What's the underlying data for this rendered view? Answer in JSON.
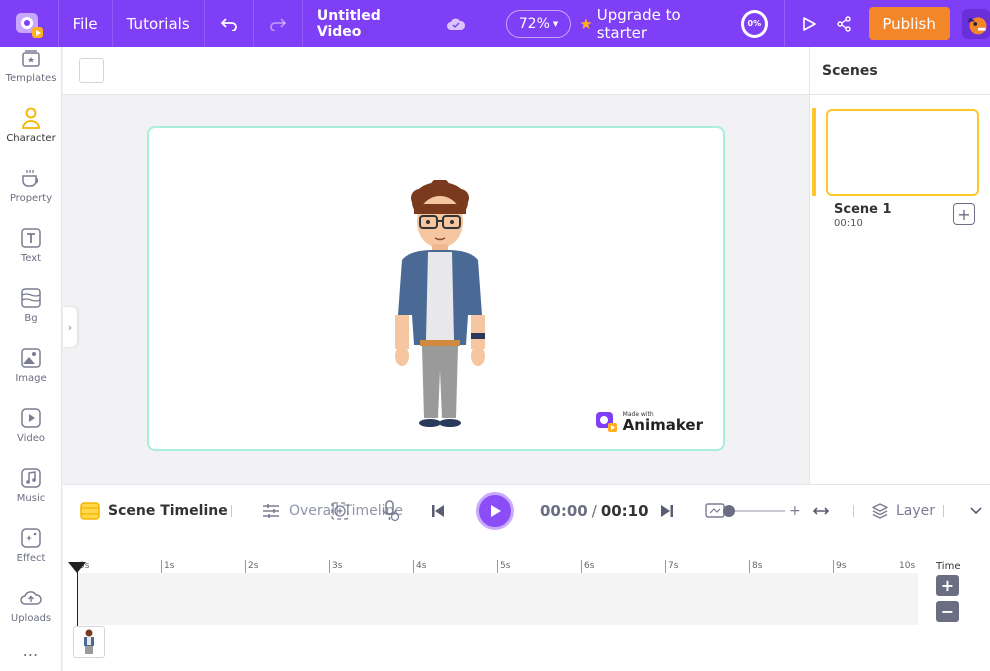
{
  "topbar": {
    "file_label": "File",
    "tutorials_label": "Tutorials",
    "project_title": "Untitled Video",
    "zoom_value": "72%",
    "upgrade_label": "Upgrade to starter",
    "progress_text": "0%",
    "publish_label": "Publish"
  },
  "sidebar": {
    "items": [
      {
        "label": "Templates",
        "icon": "templates-icon"
      },
      {
        "label": "Character",
        "icon": "character-icon"
      },
      {
        "label": "Property",
        "icon": "property-icon"
      },
      {
        "label": "Text",
        "icon": "text-icon"
      },
      {
        "label": "Bg",
        "icon": "bg-icon"
      },
      {
        "label": "Image",
        "icon": "image-icon"
      },
      {
        "label": "Video",
        "icon": "video-icon"
      },
      {
        "label": "Music",
        "icon": "music-icon"
      },
      {
        "label": "Effect",
        "icon": "effect-icon"
      },
      {
        "label": "Uploads",
        "icon": "uploads-icon"
      }
    ],
    "more_label": "⋯"
  },
  "stage": {
    "watermark_small": "Made with",
    "watermark_big": "Animaker"
  },
  "scenes": {
    "header": "Scenes",
    "items": [
      {
        "name": "Scene 1",
        "duration": "00:10"
      }
    ]
  },
  "timeline": {
    "scene_timeline_label": "Scene Timeline",
    "overall_timeline_label": "Overall Timeline",
    "current_time": "00:00",
    "separator": "/",
    "total_time": "00:10",
    "layer_label": "Layer",
    "time_label": "Time",
    "ticks": [
      "0s",
      "1s",
      "2s",
      "3s",
      "4s",
      "5s",
      "6s",
      "7s",
      "8s",
      "9s",
      "10s"
    ]
  },
  "colors": {
    "brand_purple": "#7f3ff6",
    "publish_orange": "#f4862a",
    "scene_highlight": "#ffc629",
    "stage_border": "#a8efd9",
    "upgrade_star": "#ffb020"
  }
}
